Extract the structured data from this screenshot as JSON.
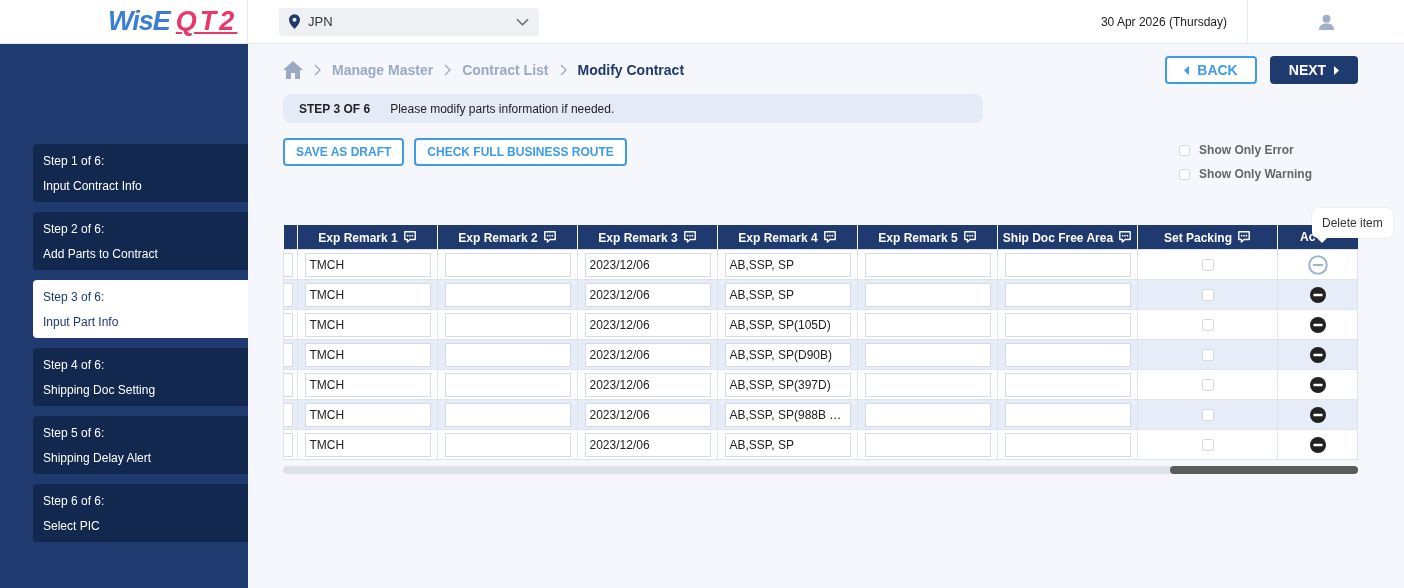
{
  "header": {
    "logo": {
      "part_1": "WisE",
      "part_2": "QT2"
    },
    "region_select": {
      "value": "JPN"
    },
    "date": "30 Apr 2026 (Thursday)"
  },
  "steps": [
    {
      "label": "Step 1 of 6:",
      "title": "Input Contract Info",
      "selected": false
    },
    {
      "label": "Step 2 of 6:",
      "title": "Add Parts to Contract",
      "selected": false
    },
    {
      "label": "Step 3 of 6:",
      "title": "Input Part Info",
      "selected": true
    },
    {
      "label": "Step 4 of 6:",
      "title": "Shipping Doc Setting",
      "selected": false
    },
    {
      "label": "Step 5 of 6:",
      "title": "Shipping Delay Alert",
      "selected": false
    },
    {
      "label": "Step 6 of 6:",
      "title": "Select PIC",
      "selected": false
    }
  ],
  "breadcrumb": [
    {
      "label": "Manage Master",
      "current": false
    },
    {
      "label": "Contract List",
      "current": false
    },
    {
      "label": "Modify Contract",
      "current": true
    }
  ],
  "nav_buttons": {
    "back": "BACK",
    "next": "NEXT"
  },
  "step_banner": {
    "step": "STEP 3 OF 6",
    "message": "Please modify parts information if needed."
  },
  "toolbar": [
    "SAVE AS DRAFT",
    "CHECK FULL BUSINESS ROUTE"
  ],
  "filters": [
    {
      "label": "Show Only Error",
      "checked": false
    },
    {
      "label": "Show Only Warning",
      "checked": false
    }
  ],
  "table": {
    "columns": [
      {
        "kind": "cut"
      },
      {
        "label": "Exp Remark 1",
        "kind": "text"
      },
      {
        "label": "Exp Remark 2",
        "kind": "text"
      },
      {
        "label": "Exp Remark 3",
        "kind": "text"
      },
      {
        "label": "Exp Remark 4",
        "kind": "text"
      },
      {
        "label": "Exp Remark 5",
        "kind": "text"
      },
      {
        "label": "Ship Doc Free Area",
        "kind": "text"
      },
      {
        "label": "Set Packing",
        "kind": "check"
      },
      {
        "label": "Ac",
        "kind": "action"
      }
    ],
    "rows": [
      {
        "exp_remark_1": "TMCH",
        "exp_remark_3": "2023/12/06",
        "exp_remark_4": "AB,SSP, SP",
        "set_packing": false,
        "hovered": true
      },
      {
        "exp_remark_1": "TMCH",
        "exp_remark_3": "2023/12/06",
        "exp_remark_4": "AB,SSP, SP",
        "set_packing": false,
        "hovered": false
      },
      {
        "exp_remark_1": "TMCH",
        "exp_remark_3": "2023/12/06",
        "exp_remark_4": "AB,SSP, SP(105D)",
        "set_packing": false,
        "hovered": false
      },
      {
        "exp_remark_1": "TMCH",
        "exp_remark_3": "2023/12/06",
        "exp_remark_4": "AB,SSP, SP(D90B)",
        "set_packing": false,
        "hovered": false
      },
      {
        "exp_remark_1": "TMCH",
        "exp_remark_3": "2023/12/06",
        "exp_remark_4": "AB,SSP, SP(397D)",
        "set_packing": false,
        "hovered": false
      },
      {
        "exp_remark_1": "TMCH",
        "exp_remark_3": "2023/12/06",
        "exp_remark_4": "AB,SSP, SP(988B …",
        "set_packing": false,
        "hovered": false
      },
      {
        "exp_remark_1": "TMCH",
        "exp_remark_3": "2023/12/06",
        "exp_remark_4": "AB,SSP, SP",
        "set_packing": false,
        "hovered": false
      }
    ]
  },
  "tooltip": "Delete item"
}
